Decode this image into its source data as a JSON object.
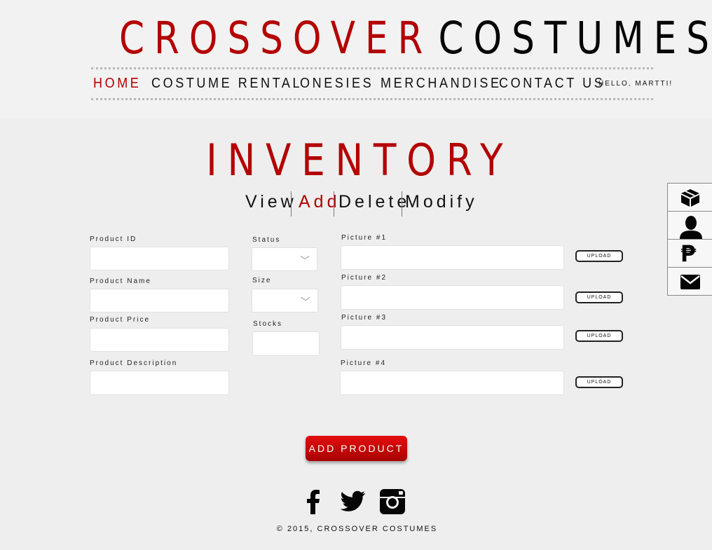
{
  "brand": {
    "part1": "CROSSOVER",
    "part2": "COSTUMES",
    "accent": "#b30000"
  },
  "nav": {
    "items": [
      "HOME",
      "COSTUME RENTAL",
      "ONESIES",
      "MERCHANDISE",
      "CONTACT US"
    ],
    "active": "HOME",
    "greeting": "HELLO, MARTTI!"
  },
  "page": {
    "title": "INVENTORY"
  },
  "subtabs": {
    "items": [
      "View",
      "Add",
      "Delete",
      "Modify"
    ],
    "active": "Add"
  },
  "form": {
    "product_id": {
      "label": "Product ID",
      "value": ""
    },
    "product_name": {
      "label": "Product Name",
      "value": ""
    },
    "product_price": {
      "label": "Product Price",
      "value": ""
    },
    "product_description": {
      "label": "Product Description",
      "value": ""
    },
    "status": {
      "label": "Status",
      "value": ""
    },
    "size": {
      "label": "Size",
      "value": ""
    },
    "stocks": {
      "label": "Stocks",
      "value": ""
    },
    "pictures": [
      {
        "label": "Picture #1",
        "value": "",
        "button": "UPLOAD"
      },
      {
        "label": "Picture #2",
        "value": "",
        "button": "UPLOAD"
      },
      {
        "label": "Picture #3",
        "value": "",
        "button": "UPLOAD"
      },
      {
        "label": "Picture #4",
        "value": "",
        "button": "UPLOAD"
      }
    ],
    "submit_label": "ADD PRODUCT"
  },
  "social": [
    "facebook-icon",
    "twitter-icon",
    "instagram-icon"
  ],
  "footer": {
    "text": "© 2015, CROSSOVER COSTUMES"
  },
  "sidebar": [
    "box-icon",
    "user-icon",
    "peso-icon",
    "mail-icon"
  ]
}
